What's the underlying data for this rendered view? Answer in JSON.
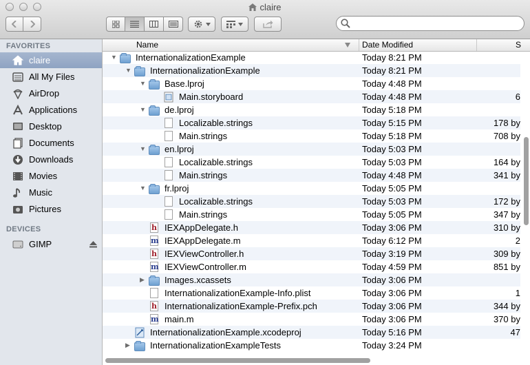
{
  "window": {
    "title": "claire"
  },
  "toolbar": {
    "back_icon": "chevron-left-icon",
    "forward_icon": "chevron-right-icon",
    "view_modes": [
      "icon-view",
      "list-view",
      "column-view",
      "cover-flow-view"
    ],
    "active_view": "list-view",
    "action_icon": "gear-icon",
    "arrange_icon": "arrange-icon",
    "share_icon": "share-icon",
    "search_placeholder": ""
  },
  "sidebar": {
    "favorites_header": "FAVORITES",
    "favorites": [
      {
        "label": "claire",
        "icon": "home-icon",
        "selected": true
      },
      {
        "label": "All My Files",
        "icon": "all-files-icon"
      },
      {
        "label": "AirDrop",
        "icon": "airdrop-icon"
      },
      {
        "label": "Applications",
        "icon": "applications-icon"
      },
      {
        "label": "Desktop",
        "icon": "desktop-icon"
      },
      {
        "label": "Documents",
        "icon": "documents-icon"
      },
      {
        "label": "Downloads",
        "icon": "downloads-icon"
      },
      {
        "label": "Movies",
        "icon": "movies-icon"
      },
      {
        "label": "Music",
        "icon": "music-icon"
      },
      {
        "label": "Pictures",
        "icon": "pictures-icon"
      }
    ],
    "devices_header": "DEVICES",
    "devices": [
      {
        "label": "GIMP",
        "icon": "disk-icon"
      }
    ]
  },
  "columns": {
    "name": "Name",
    "date": "Date Modified",
    "size": "S"
  },
  "rows": [
    {
      "name": "InternationalizationExample",
      "date": "Today 8:21 PM",
      "size": "",
      "depth": 0,
      "kind": "folder",
      "disclosure": "open"
    },
    {
      "name": "InternationalizationExample",
      "date": "Today 8:21 PM",
      "size": "",
      "depth": 1,
      "kind": "folder",
      "disclosure": "open"
    },
    {
      "name": "Base.lproj",
      "date": "Today 4:48 PM",
      "size": "",
      "depth": 2,
      "kind": "folder",
      "disclosure": "open"
    },
    {
      "name": "Main.storyboard",
      "date": "Today 4:48 PM",
      "size": "6",
      "depth": 3,
      "kind": "storyboard"
    },
    {
      "name": "de.lproj",
      "date": "Today 5:18 PM",
      "size": "",
      "depth": 2,
      "kind": "folder",
      "disclosure": "open"
    },
    {
      "name": "Localizable.strings",
      "date": "Today 5:15 PM",
      "size": "178 by",
      "depth": 3,
      "kind": "doc"
    },
    {
      "name": "Main.strings",
      "date": "Today 5:18 PM",
      "size": "708 by",
      "depth": 3,
      "kind": "doc"
    },
    {
      "name": "en.lproj",
      "date": "Today 5:03 PM",
      "size": "",
      "depth": 2,
      "kind": "folder",
      "disclosure": "open"
    },
    {
      "name": "Localizable.strings",
      "date": "Today 5:03 PM",
      "size": "164 by",
      "depth": 3,
      "kind": "doc"
    },
    {
      "name": "Main.strings",
      "date": "Today 4:48 PM",
      "size": "341 by",
      "depth": 3,
      "kind": "doc"
    },
    {
      "name": "fr.lproj",
      "date": "Today 5:05 PM",
      "size": "",
      "depth": 2,
      "kind": "folder",
      "disclosure": "open"
    },
    {
      "name": "Localizable.strings",
      "date": "Today 5:03 PM",
      "size": "172 by",
      "depth": 3,
      "kind": "doc"
    },
    {
      "name": "Main.strings",
      "date": "Today 5:05 PM",
      "size": "347 by",
      "depth": 3,
      "kind": "doc"
    },
    {
      "name": "IEXAppDelegate.h",
      "date": "Today 3:06 PM",
      "size": "310 by",
      "depth": 2,
      "kind": "h"
    },
    {
      "name": "IEXAppDelegate.m",
      "date": "Today 6:12 PM",
      "size": "2",
      "depth": 2,
      "kind": "m"
    },
    {
      "name": "IEXViewController.h",
      "date": "Today 3:19 PM",
      "size": "309 by",
      "depth": 2,
      "kind": "h"
    },
    {
      "name": "IEXViewController.m",
      "date": "Today 4:59 PM",
      "size": "851 by",
      "depth": 2,
      "kind": "m"
    },
    {
      "name": "Images.xcassets",
      "date": "Today 3:06 PM",
      "size": "",
      "depth": 2,
      "kind": "folder",
      "disclosure": "closed"
    },
    {
      "name": "InternationalizationExample-Info.plist",
      "date": "Today 3:06 PM",
      "size": "1",
      "depth": 2,
      "kind": "doc"
    },
    {
      "name": "InternationalizationExample-Prefix.pch",
      "date": "Today 3:06 PM",
      "size": "344 by",
      "depth": 2,
      "kind": "h"
    },
    {
      "name": "main.m",
      "date": "Today 3:06 PM",
      "size": "370 by",
      "depth": 2,
      "kind": "m"
    },
    {
      "name": "InternationalizationExample.xcodeproj",
      "date": "Today 5:16 PM",
      "size": "47",
      "depth": 1,
      "kind": "xcodeproj"
    },
    {
      "name": "InternationalizationExampleTests",
      "date": "Today 3:24 PM",
      "size": "",
      "depth": 1,
      "kind": "folder",
      "disclosure": "closed"
    }
  ]
}
